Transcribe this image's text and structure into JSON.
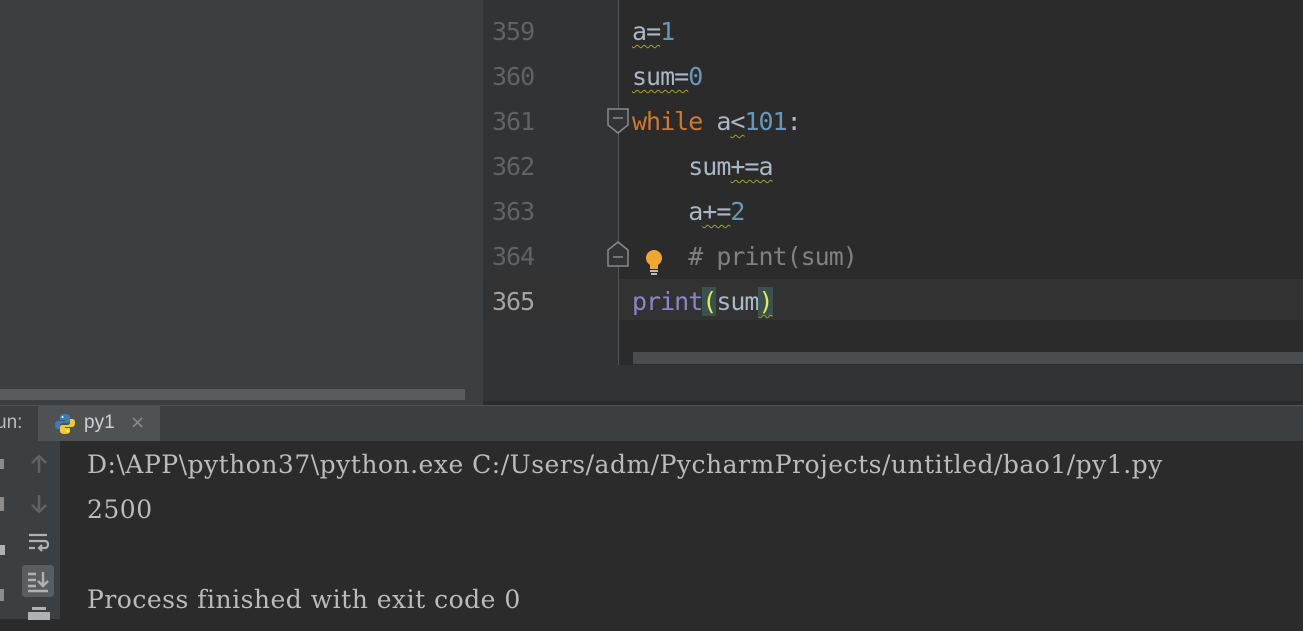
{
  "editor": {
    "lines": [
      {
        "no": "359"
      },
      {
        "no": "360"
      },
      {
        "no": "361"
      },
      {
        "no": "362"
      },
      {
        "no": "363"
      },
      {
        "no": "364"
      },
      {
        "no": "365"
      }
    ],
    "code": {
      "l359_a": "a",
      "l359_eq": "=",
      "l359_num": "1",
      "l360_sum": "sum",
      "l360_eq": "=",
      "l360_num": "0",
      "l361_kw": "while",
      "l361_sp": " ",
      "l361_a": "a",
      "l361_lt": "<",
      "l361_num": "101",
      "l361_colon": ":",
      "l362_indent": "    ",
      "l362_sum": "sum",
      "l362_op": "+=",
      "l362_a": "a",
      "l363_indent": "    ",
      "l363_a": "a",
      "l363_op": "+=",
      "l363_num": "2",
      "l364_indent": "    ",
      "l364_comment": "# print(sum)",
      "l365_print": "print",
      "l365_open": "(",
      "l365_arg": "sum",
      "l365_close": ")"
    }
  },
  "run": {
    "label": "un:",
    "tab_label": "py1",
    "tab_close": "×"
  },
  "console": {
    "command": "D:\\APP\\python37\\python.exe C:/Users/adm/PycharmProjects/untitled/bao1/py1.py",
    "output": "2500",
    "exit_message": "Process finished with exit code 0"
  },
  "icons": {
    "fold": "fold-icon",
    "bulb": "lightbulb-icon",
    "python": "python-icon",
    "rerun_up": "arrow-up-icon",
    "rerun_down": "arrow-down-icon",
    "wrap": "soft-wrap-icon",
    "scroll_end": "scroll-to-end-icon",
    "print": "print-icon"
  }
}
